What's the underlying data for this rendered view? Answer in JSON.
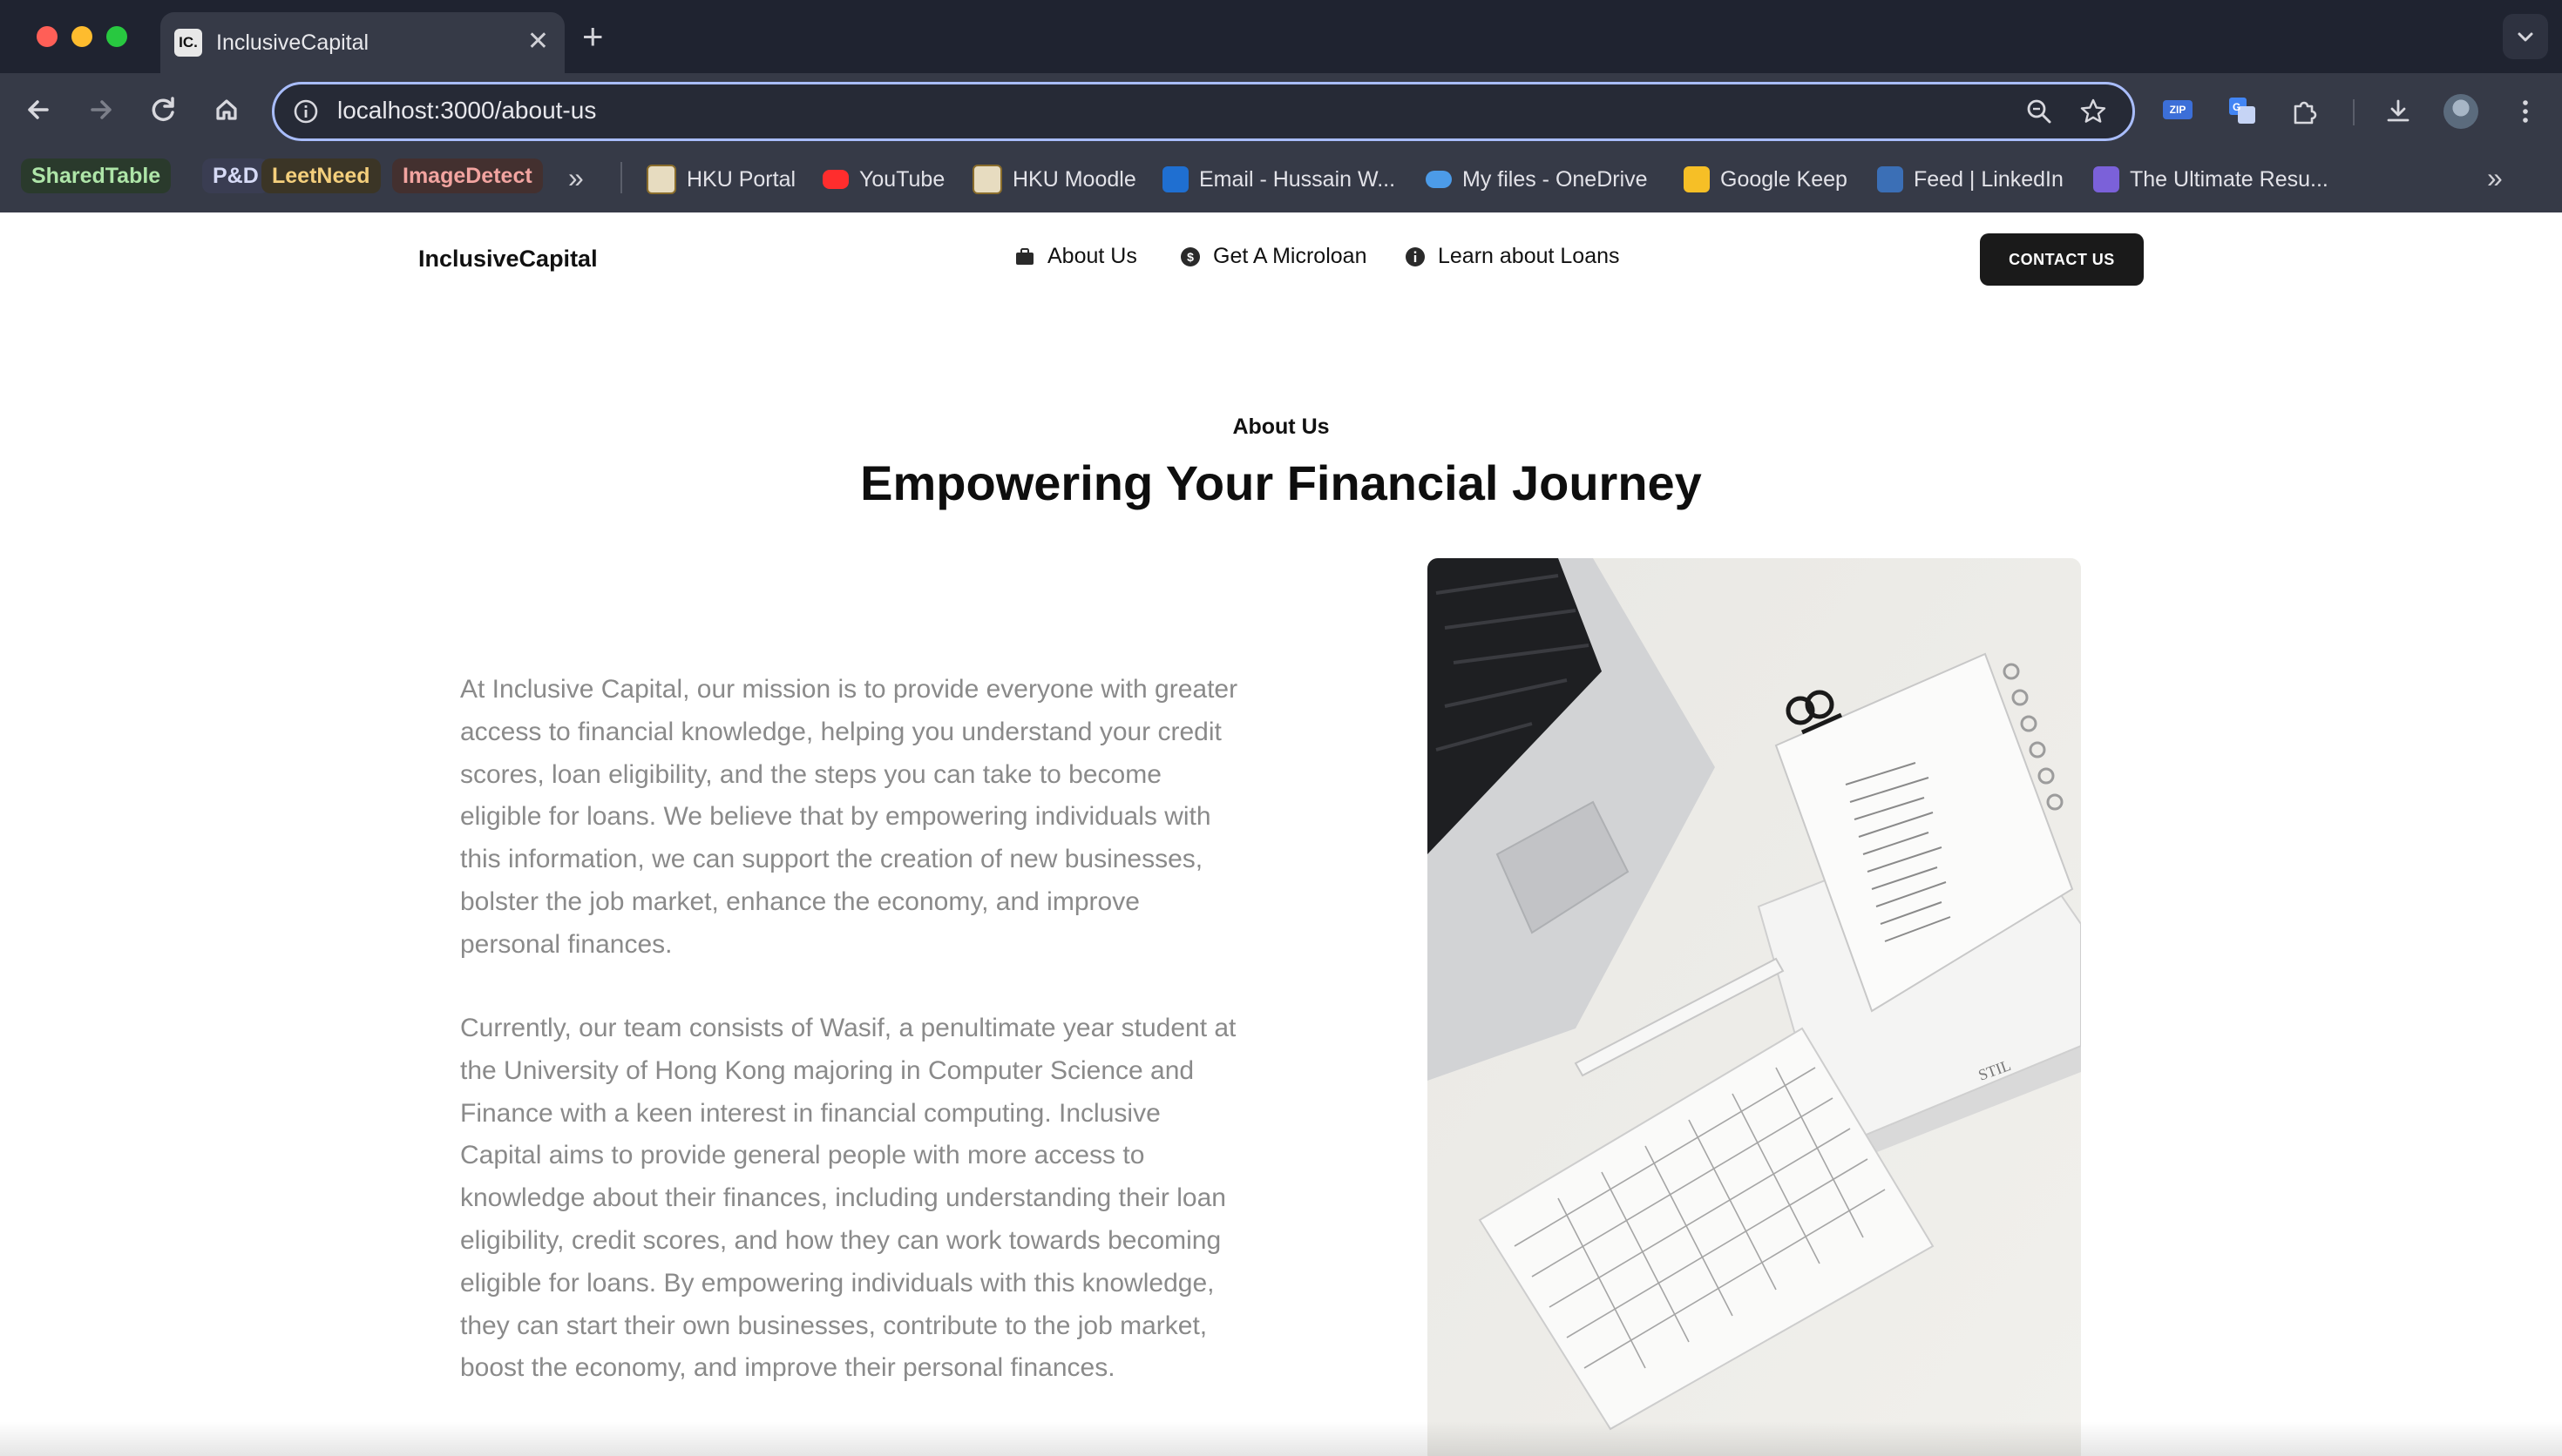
{
  "browser": {
    "tab_title": "InclusiveCapital",
    "tab_favicon_text": "IC.",
    "url": "localhost:3000/about-us",
    "bookmarks_pills": [
      {
        "label": "SharedTable",
        "color": "#2e7d32"
      },
      {
        "label": "P&D",
        "color": "#3949ab"
      },
      {
        "label": "LeetNeed",
        "color": "#f6b93b"
      },
      {
        "label": "ImageDetect",
        "color": "#e57373"
      }
    ],
    "bookmarks": [
      {
        "label": "HKU Portal",
        "icon": "hku-portal-icon"
      },
      {
        "label": "YouTube",
        "icon": "youtube-icon"
      },
      {
        "label": "HKU Moodle",
        "icon": "hku-moodle-icon"
      },
      {
        "label": "Email - Hussain W...",
        "icon": "outlook-icon"
      },
      {
        "label": "My files - OneDrive",
        "icon": "onedrive-icon"
      },
      {
        "label": "Google Keep",
        "icon": "google-keep-icon"
      },
      {
        "label": "Feed | LinkedIn",
        "icon": "linkedin-icon"
      },
      {
        "label": "The Ultimate Resu...",
        "icon": "resume-icon"
      }
    ],
    "extension_zip_text": "ZIP"
  },
  "site": {
    "brand": "InclusiveCapital",
    "nav": [
      {
        "label": "About Us",
        "icon": "briefcase-icon"
      },
      {
        "label": "Get A Microloan",
        "icon": "dollar-circle-icon"
      },
      {
        "label": "Learn about Loans",
        "icon": "info-circle-icon"
      }
    ],
    "contact_label": "CONTACT US"
  },
  "about": {
    "eyebrow": "About Us",
    "headline": "Empowering Your Financial Journey",
    "paragraph1": "At Inclusive Capital, our mission is to provide everyone with greater access to financial knowledge, helping you understand your credit scores, loan eligibility, and the steps you can take to become eligible for loans. We believe that by empowering individuals with this information, we can support the creation of new businesses, bolster the job market, enhance the economy, and improve personal finances.",
    "paragraph2": "Currently, our team consists of Wasif, a penultimate year student at the University of Hong Kong majoring in Computer Science and Finance with a keen interest in financial computing. Inclusive Capital aims to provide general people with more access to knowledge about their finances, including understanding their loan eligibility, credit scores, and how they can work towards becoming eligible for loans. By empowering individuals with this knowledge, they can start their own businesses, contribute to the job market, boost the economy, and improve their personal finances.",
    "photo_alt": "Laptop, notebook and monthly planner on a desk"
  },
  "colors": {
    "chrome_bg": "#1f2330",
    "toolbar_bg": "#363a47",
    "omnibox_border": "#a9bdfc",
    "body_text_muted": "#8a8a8a",
    "button_dark": "#1a1a1a"
  }
}
